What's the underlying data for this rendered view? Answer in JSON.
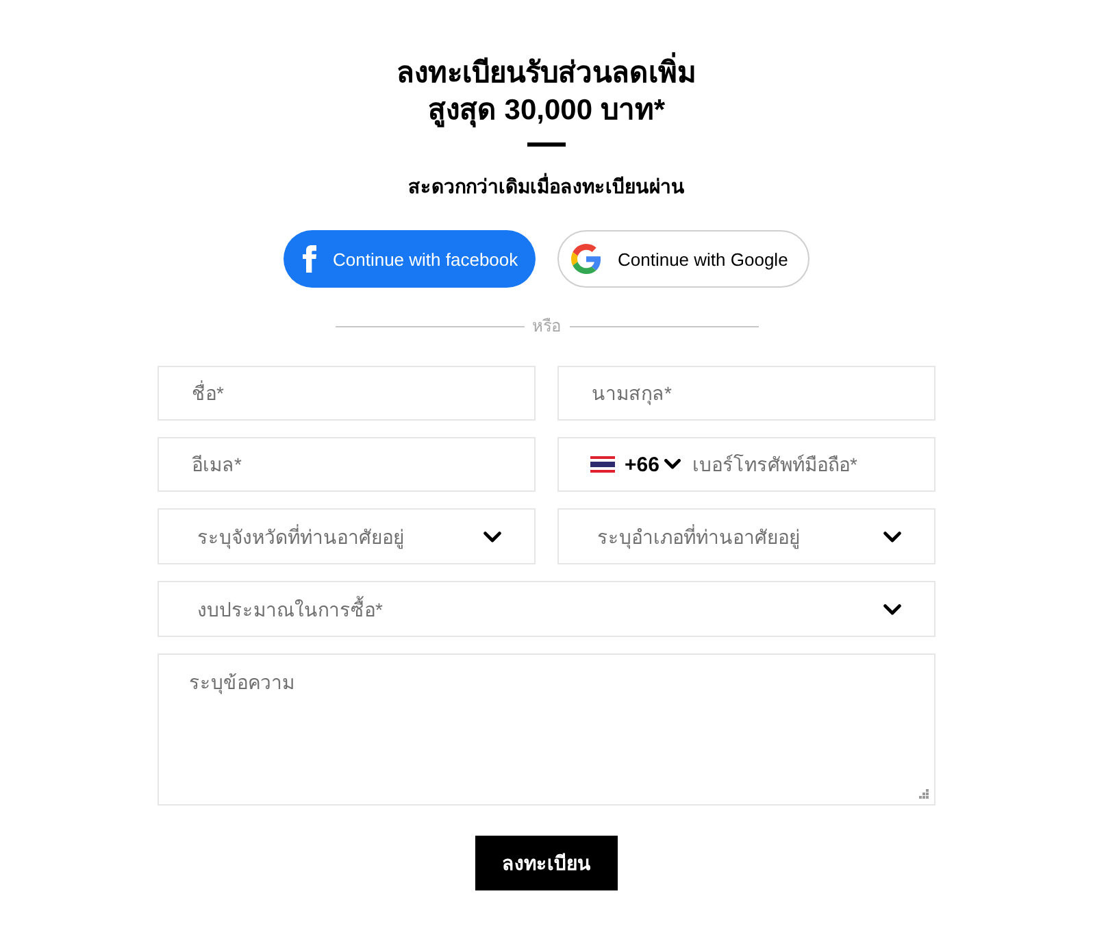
{
  "heading": {
    "title_lines": [
      "ลงทะเบียนรับส่วนลดเพิ่ม",
      "สูงสุด 30,000 บาท*"
    ],
    "subtitle": "สะดวกกว่าเดิมเมื่อลงทะเบียนผ่าน"
  },
  "social_buttons": [
    {
      "kind": "facebook",
      "label": "Continue with facebook"
    },
    {
      "kind": "google",
      "label": "Continue with Google"
    }
  ],
  "divider": {
    "label": "หรือ"
  },
  "form": {
    "rows": [
      [
        {
          "kind": "text",
          "placeholder": "ชื่อ*"
        },
        {
          "kind": "text",
          "placeholder": "นามสกุล*"
        }
      ],
      [
        {
          "kind": "text",
          "placeholder": "อีเมล*"
        },
        {
          "kind": "phone",
          "country_code": "+66",
          "placeholder": "เบอร์โทรศัพท์มือถือ*"
        }
      ],
      [
        {
          "kind": "select",
          "placeholder": "ระบุจังหวัดที่ท่านอาศัยอยู่"
        },
        {
          "kind": "select",
          "placeholder": "ระบุอำเภอที่ท่านอาศัยอยู่"
        }
      ],
      [
        {
          "kind": "select",
          "placeholder": "งบประมาณในการซื้อ*"
        }
      ],
      [
        {
          "kind": "textarea",
          "placeholder": "ระบุข้อความ"
        }
      ]
    ],
    "submit_button": {
      "label": "ลงทะเบียน"
    }
  }
}
